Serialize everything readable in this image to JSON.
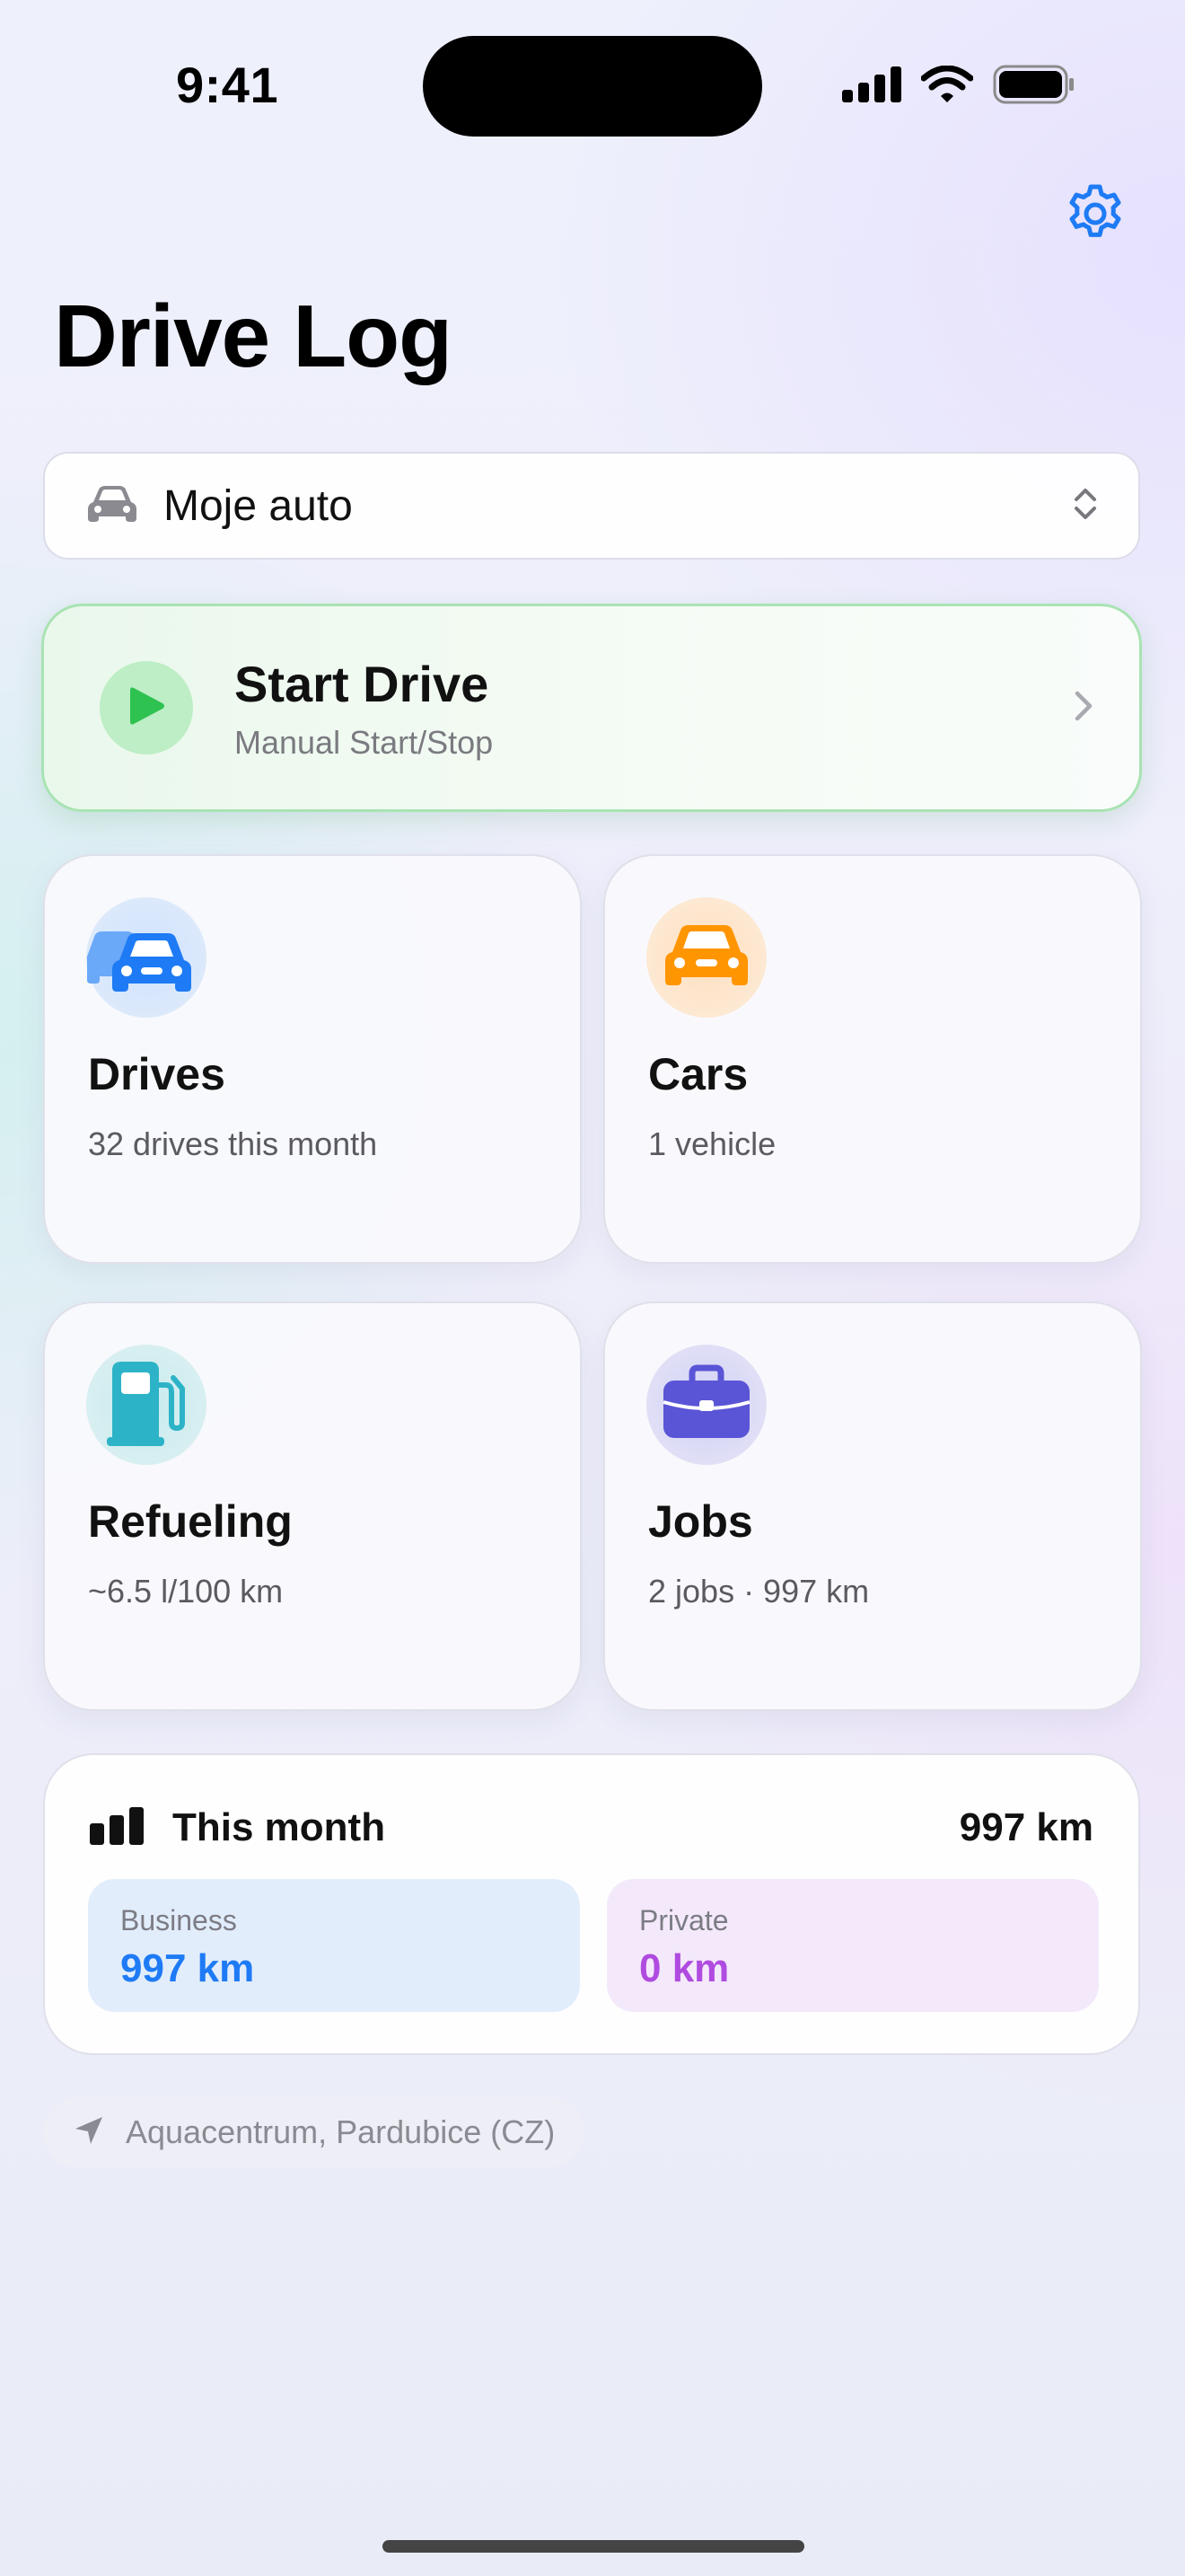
{
  "status_bar": {
    "time": "9:41",
    "icons": [
      "cellular-signal-icon",
      "wifi-icon",
      "battery-icon"
    ]
  },
  "header": {
    "title": "Drive Log",
    "settings_icon": "gear-icon"
  },
  "car_picker": {
    "icon": "car-icon",
    "selected": "Moje auto",
    "chevron_icon": "up-down-chevron-icon"
  },
  "start_drive": {
    "title": "Start Drive",
    "subtitle": "Manual Start/Stop",
    "icon": "play-icon"
  },
  "tiles": [
    {
      "key": "drives",
      "title": "Drives",
      "subtitle": "32 drives this month",
      "icon": "two-cars-icon",
      "color": "#1E7BF5"
    },
    {
      "key": "cars",
      "title": "Cars",
      "subtitle": "1 vehicle",
      "icon": "car-icon",
      "color": "#FF9500"
    },
    {
      "key": "refueling",
      "title": "Refueling",
      "subtitle": "~6.5 l/100 km",
      "icon": "fuel-pump-icon",
      "color": "#2DB3C7"
    },
    {
      "key": "jobs",
      "title": "Jobs",
      "subtitle": "2 jobs · 997 km",
      "icon": "briefcase-icon",
      "color": "#5A55D6"
    }
  ],
  "this_month": {
    "title": "This month",
    "total": "997 km",
    "icon": "bar-chart-icon",
    "business": {
      "label": "Business",
      "value": "997 km",
      "color": "#1E7BF5"
    },
    "private": {
      "label": "Private",
      "value": "0 km",
      "color": "#B04BE0"
    }
  },
  "location": {
    "icon": "location-arrow-icon",
    "text": "Aquacentrum, Pardubice (CZ)"
  }
}
